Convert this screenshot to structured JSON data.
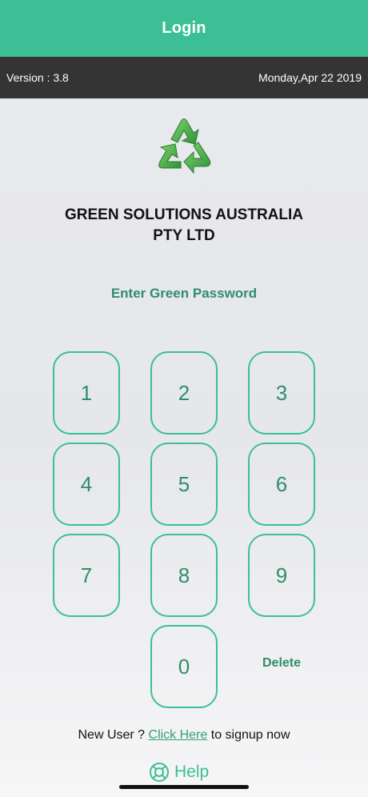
{
  "header": {
    "title": "Login"
  },
  "info_bar": {
    "version": "Version : 3.8",
    "date": "Monday,Apr 22 2019"
  },
  "logo": {
    "icon": "recycle-icon",
    "color": "#3aa645"
  },
  "company": {
    "line1": "GREEN SOLUTIONS AUSTRALIA",
    "line2": "PTY LTD"
  },
  "prompt": "Enter Green Password",
  "keypad": {
    "keys": [
      "1",
      "2",
      "3",
      "4",
      "5",
      "6",
      "7",
      "8",
      "9",
      "0"
    ],
    "delete_label": "Delete"
  },
  "signup": {
    "prefix": "New User ? ",
    "link": "Click Here",
    "suffix": " to signup now"
  },
  "help": {
    "label": "Help",
    "icon": "lifebuoy-icon"
  },
  "colors": {
    "accent": "#3cbf94",
    "info_bar": "#343434",
    "text_green": "#2f8d6c"
  }
}
